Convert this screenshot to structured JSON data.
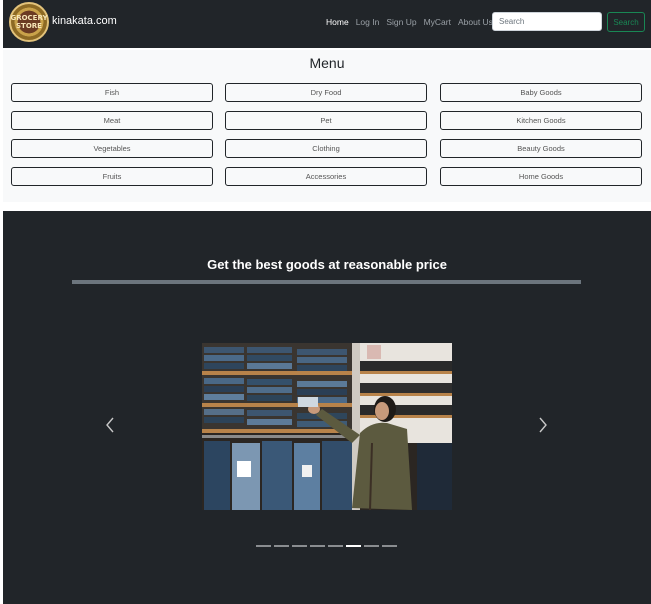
{
  "navbar": {
    "logo_text": "GROCERY STORE",
    "brand": "kinakata.com",
    "links": [
      {
        "label": "Home",
        "active": true
      },
      {
        "label": "Log In",
        "active": false
      },
      {
        "label": "Sign Up",
        "active": false
      },
      {
        "label": "MyCart",
        "active": false
      },
      {
        "label": "About Us",
        "active": false
      }
    ],
    "search_placeholder": "Search",
    "search_button": "Search"
  },
  "menu": {
    "title": "Menu",
    "columns": [
      [
        "Fish",
        "Meat",
        "Vegetables",
        "Fruits"
      ],
      [
        "Dry Food",
        "Pet",
        "Clothing",
        "Accessories"
      ],
      [
        "Baby Goods",
        "Kitchen Goods",
        "Beauty Goods",
        "Home Goods"
      ]
    ]
  },
  "hero": {
    "title": "Get the best goods at reasonable price",
    "prev_icon": "chevron-left-icon",
    "next_icon": "chevron-right-icon",
    "indicator_count": 8,
    "active_indicator": 5
  },
  "colors": {
    "dark": "#212529",
    "light": "#f8f9fa",
    "success": "#198754"
  }
}
